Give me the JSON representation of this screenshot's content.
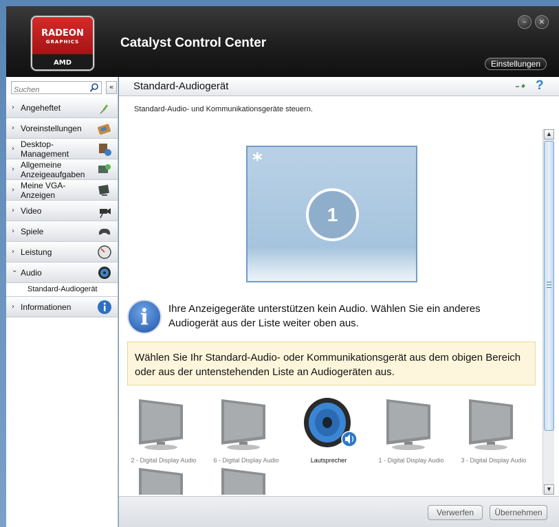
{
  "app": {
    "title": "Catalyst Control Center",
    "logo": {
      "line1": "RADEON",
      "line2": "GRAPHICS",
      "line3": "AMD"
    },
    "settings_label": "Einstellungen",
    "window_controls": {
      "minimize": "–",
      "close": "×"
    }
  },
  "sidebar": {
    "search_placeholder": "Suchen",
    "collapse_label": "«",
    "items": [
      {
        "label": "Angeheftet",
        "icon": "pin-icon",
        "expanded": false
      },
      {
        "label": "Voreinstellungen",
        "icon": "presets-icon",
        "expanded": false
      },
      {
        "label": "Desktop-Management",
        "icon": "desktop-management-icon",
        "expanded": false
      },
      {
        "label": "Allgemeine Anzeigeaufgaben",
        "icon": "display-tasks-icon",
        "expanded": false
      },
      {
        "label": "Meine VGA-Anzeigen",
        "icon": "vga-display-icon",
        "expanded": false
      },
      {
        "label": "Video",
        "icon": "video-camera-icon",
        "expanded": false
      },
      {
        "label": "Spiele",
        "icon": "gamepad-icon",
        "expanded": false
      },
      {
        "label": "Leistung",
        "icon": "gauge-icon",
        "expanded": false
      },
      {
        "label": "Audio",
        "icon": "speaker-icon",
        "expanded": true
      },
      {
        "label": "Informationen",
        "icon": "info-icon",
        "expanded": false
      }
    ],
    "sub_item": "Standard-Audiogerät",
    "chevron_collapsed": "›",
    "chevron_expanded": "⌄"
  },
  "page": {
    "title": "Standard-Audiogerät",
    "help_label": "?",
    "description": "Standard-Audio- und Kommunikationsgeräte steuern.",
    "display": {
      "marker": "*",
      "number": "1"
    },
    "info_text": "Ihre Anzeigegeräte unterstützen kein Audio. Wählen Sie ein anderes Audiogerät aus der Liste weiter oben aus.",
    "hint_text": "Wählen Sie Ihr Standard-Audio- oder Kommunikationsgerät aus dem obigen Bereich oder aus der untenstehenden Liste an Audiogeräten aus.",
    "devices": [
      {
        "label": "2 - Digital Display Audio",
        "type": "monitor",
        "selected": false
      },
      {
        "label": "6 - Digital Display Audio",
        "type": "monitor",
        "selected": false
      },
      {
        "label": "Lautsprecher",
        "type": "speaker",
        "selected": true
      },
      {
        "label": "1 - Digital Display Audio",
        "type": "monitor",
        "selected": false
      },
      {
        "label": "3 - Digital Display Audio",
        "type": "monitor",
        "selected": false
      },
      {
        "label": "",
        "type": "monitor",
        "selected": false
      },
      {
        "label": "",
        "type": "monitor",
        "selected": false
      }
    ]
  },
  "footer": {
    "discard_label": "Verwerfen",
    "apply_label": "Übernehmen"
  },
  "colors": {
    "accent_blue": "#2f7fc5",
    "amd_red": "#c81e1e",
    "hint_background": "#fdf6dc"
  }
}
